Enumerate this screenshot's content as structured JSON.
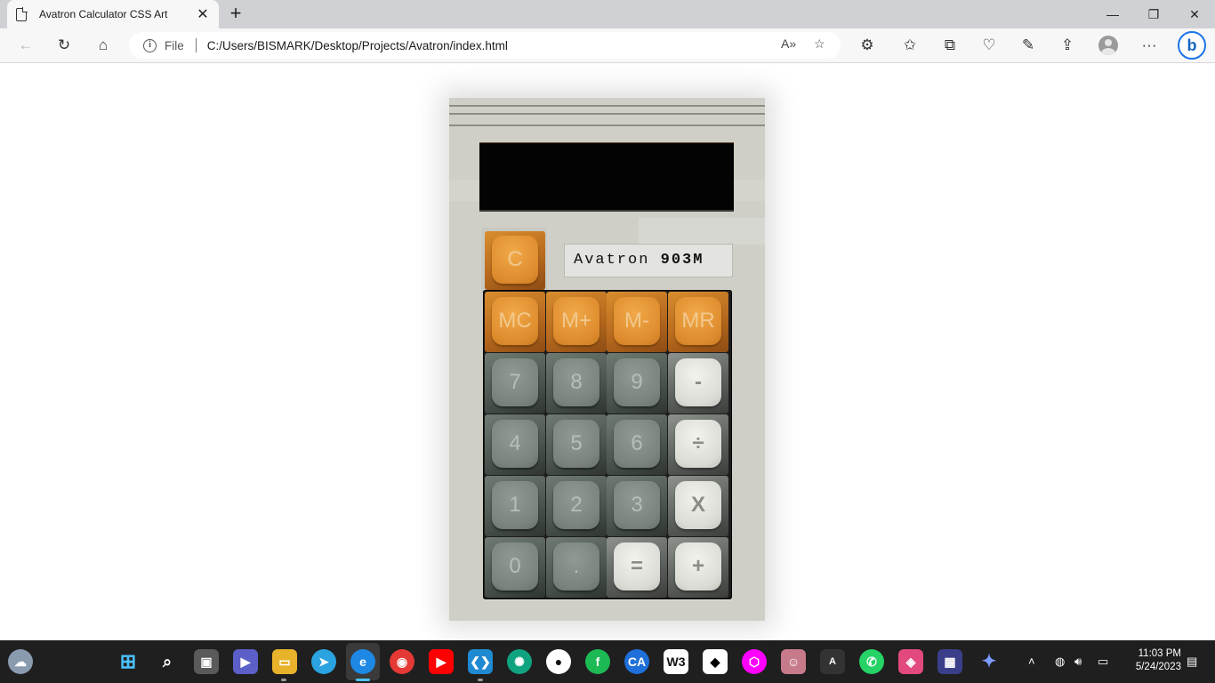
{
  "browser": {
    "tab_title": "Avatron Calculator CSS Art",
    "address_label": "File",
    "url": "C:/Users/BISMARK/Desktop/Projects/Avatron/index.html"
  },
  "calculator": {
    "brand_name": "Avatron",
    "brand_model": "903M",
    "display_value": "",
    "keys": {
      "clear": "C",
      "memory": [
        "MC",
        "M+",
        "M-",
        "MR"
      ],
      "row1": [
        "7",
        "8",
        "9",
        "-"
      ],
      "row2": [
        "4",
        "5",
        "6",
        "÷"
      ],
      "row3": [
        "1",
        "2",
        "3",
        "X"
      ],
      "row4": [
        "0",
        ".",
        "=",
        "+"
      ]
    },
    "colors": {
      "body": "#cfcfc7",
      "orange_key": "#de8c2e",
      "gray_key": "#7a847d",
      "light_key": "#dcdcd6",
      "display": "#030303"
    }
  },
  "taskbar": {
    "time": "11:03 PM",
    "date": "5/24/2023"
  }
}
